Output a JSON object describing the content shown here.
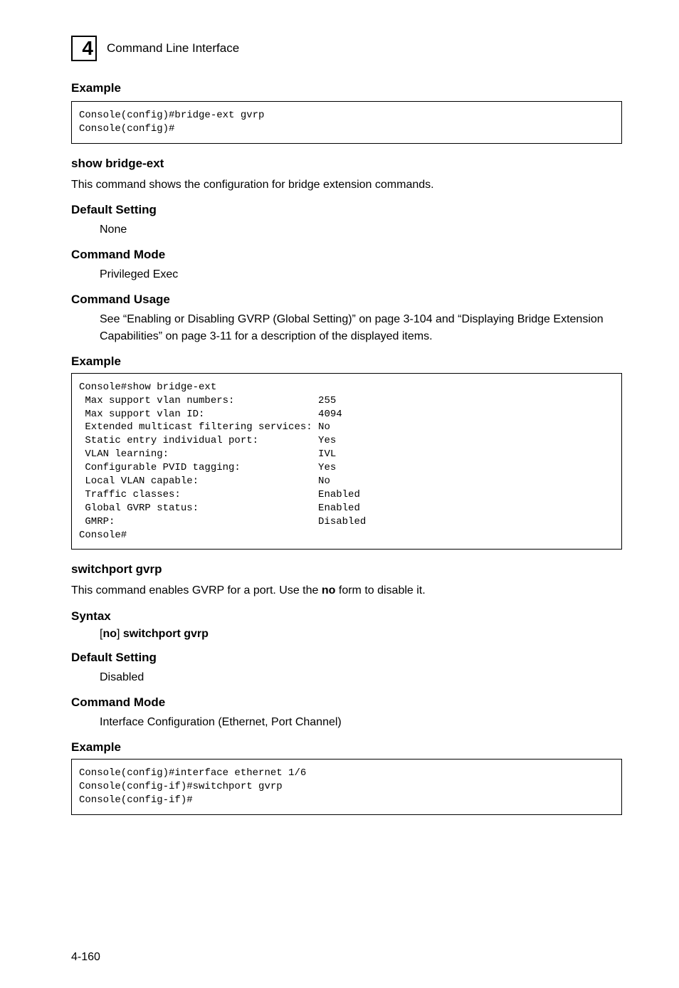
{
  "header": {
    "chapter_number": "4",
    "title": "Command Line Interface"
  },
  "s1": {
    "heading": "Example",
    "code": "Console(config)#bridge-ext gvrp\nConsole(config)#"
  },
  "s2": {
    "heading": "show bridge-ext",
    "desc": "This command shows the configuration for bridge extension commands."
  },
  "s3": {
    "heading": "Default Setting",
    "value": "None"
  },
  "s4": {
    "heading": "Command Mode",
    "value": "Privileged Exec"
  },
  "s5": {
    "heading": "Command Usage",
    "value": "See “Enabling or Disabling GVRP (Global Setting)” on page 3-104 and “Displaying Bridge Extension Capabilities” on page 3-11 for a description of the displayed items."
  },
  "s6": {
    "heading": "Example",
    "code": "Console#show bridge-ext\n Max support vlan numbers:              255\n Max support vlan ID:                   4094\n Extended multicast filtering services: No\n Static entry individual port:          Yes\n VLAN learning:                         IVL\n Configurable PVID tagging:             Yes\n Local VLAN capable:                    No\n Traffic classes:                       Enabled\n Global GVRP status:                    Enabled\n GMRP:                                  Disabled\nConsole#"
  },
  "s7": {
    "heading": "switchport gvrp",
    "desc_pre": "This command enables GVRP for a port. Use the ",
    "desc_bold": "no",
    "desc_post": " form to disable it."
  },
  "s8": {
    "heading": "Syntax",
    "open_br": "[",
    "no": "no",
    "close_br": "] ",
    "cmd": "switchport gvrp"
  },
  "s9": {
    "heading": "Default Setting",
    "value": "Disabled"
  },
  "s10": {
    "heading": "Command Mode",
    "value": "Interface Configuration (Ethernet, Port Channel)"
  },
  "s11": {
    "heading": "Example",
    "code": "Console(config)#interface ethernet 1/6\nConsole(config-if)#switchport gvrp\nConsole(config-if)#"
  },
  "footer": {
    "page_number": "4-160"
  }
}
